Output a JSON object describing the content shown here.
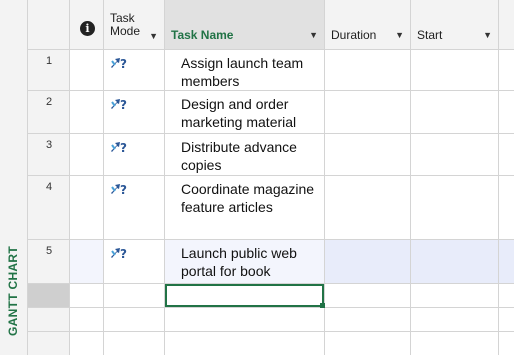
{
  "view_label": "GANTT CHART",
  "columns": {
    "info_icon": "info-icon",
    "task_mode": "Task Mode",
    "task_mode_line1": "Task",
    "task_mode_line2": "Mode",
    "task_name": "Task Name",
    "duration": "Duration",
    "start": "Start"
  },
  "tasks": [
    {
      "id": "1",
      "name": "Assign launch team members",
      "mode_icon": "manual-schedule-icon"
    },
    {
      "id": "2",
      "name": "Design and order marketing material",
      "mode_icon": "manual-schedule-icon"
    },
    {
      "id": "3",
      "name": "Distribute advance copies",
      "mode_icon": "manual-schedule-icon"
    },
    {
      "id": "4",
      "name": "Coordinate magazine feature articles",
      "mode_icon": "manual-schedule-icon"
    },
    {
      "id": "5",
      "name": "Launch public web portal for book",
      "mode_icon": "manual-schedule-icon"
    }
  ],
  "colors": {
    "accent": "#217346",
    "highlight": "#e8ecfa",
    "active_cell_border": "#217346"
  }
}
